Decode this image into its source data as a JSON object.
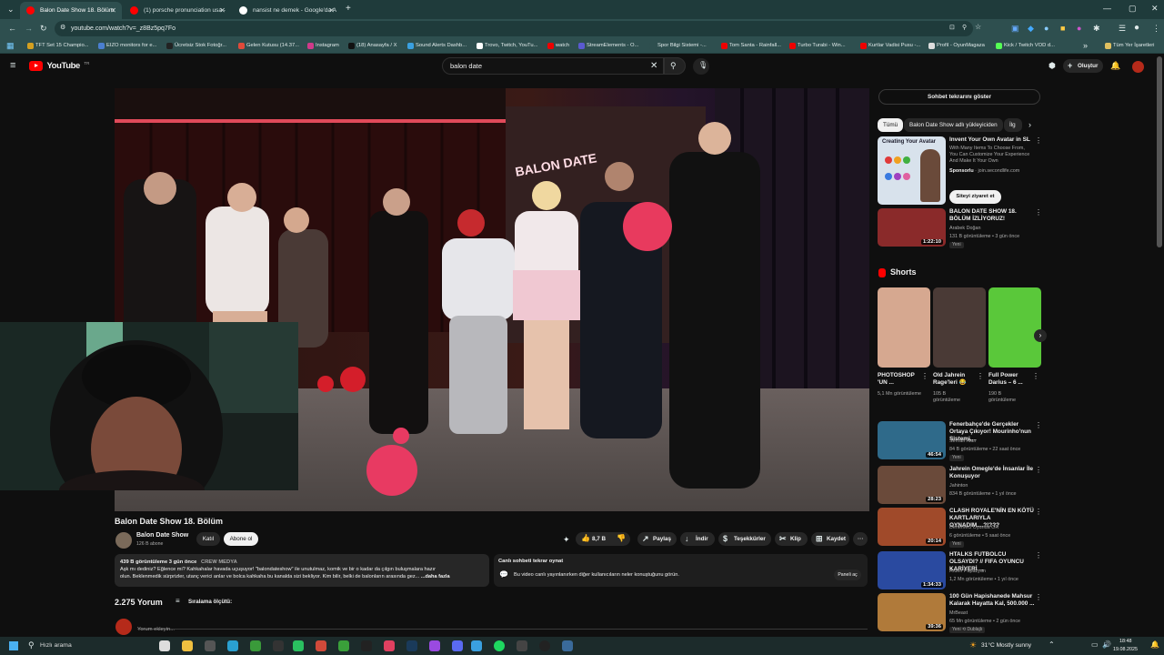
{
  "browser": {
    "tabs": [
      {
        "label": "Balon Date Show 18. Bölüm",
        "active": true
      },
      {
        "label": "(1) porsche pronunciation usa -",
        "active": false
      },
      {
        "label": "nansist ne demek - Google'da A",
        "active": false
      }
    ],
    "new_tab": "+",
    "url": "youtube.com/watch?v=_z8Bz5pq7Fo",
    "bookmarks": [
      "TFT Set 15 Champio...",
      "EIZO monitors for e...",
      "Ücretsiz Stok Fotoğr...",
      "Gelen Kutusu (14.37...",
      "Instagram",
      "(18) Anasayfa / X",
      "Sound Alerts Dashb...",
      "Trovo, Twitch, YouTu...",
      "watch",
      "StreamElements - O...",
      "Spor Bilgi Sistemi -...",
      "Tom Santa - Rainfall...",
      "Turbo Turabi - Win...",
      "Kurtlar Vadisi Pusu -...",
      "Profil - OyunMagaza",
      "Kick / Twitch VOD d..."
    ],
    "all_bookmarks": "Tüm Yer İşaretleri"
  },
  "youtube": {
    "logo": "YouTube",
    "country": "TR",
    "search_value": "balon date",
    "create_label": "Oluştur"
  },
  "video": {
    "title": "Balon Date Show 18. Bölüm",
    "overlay_text": "BALON DATE",
    "channel": "Balon Date Show",
    "subscribers": "126 B abone",
    "join_label": "Katıl",
    "subscribe_label": "Abone ol",
    "likes": "8,7 B",
    "share_label": "Paylaş",
    "download_label": "İndir",
    "thanks_label": "Teşekkürler",
    "clip_label": "Klip",
    "save_label": "Kaydet",
    "desc_stats": "439 B görüntüleme  3 gün önce",
    "desc_tag": "CREW MEDYA",
    "desc_line1": "Aşk mı dediniz? Eğlence mi? Kahkahalar havada uçuşuyor! \"balondateshow\" ile unutulmaz, komik ve bir o kadar da çılgın buluşmalara hazır",
    "desc_line2": "olun. Beklenmedik sürprizler, utanç verici anlar ve bolca kahkaha bu kanalda sizi bekliyor. Kim bilir, belki de balonların arasında gez...",
    "desc_more": "...daha fazla",
    "chat_replay_title": "Canlı sohbeti tekrar oynat",
    "chat_replay_text": "Bu video canlı yayınlanırken diğer kullanıcıların neler konuştuğunu görün.",
    "chat_open": "Paneli aç",
    "comments_count": "2.275 Yorum",
    "sort_label": "Sıralama ölçütü:",
    "comment_placeholder": "Yorum ekleyin..."
  },
  "sidebar": {
    "chat_button": "Sohbet tekrarını göster",
    "chips": [
      "Tümü",
      "Balon Date Show adlı yükleyiciden",
      "İlg"
    ],
    "ad": {
      "thumb_title": "Creating Your Avatar",
      "title": "Invent Your Own Avatar in SL",
      "desc": "With Many Items To Choose From, You Can Customize Your Experience And Make It Your Own",
      "sponsor": "Sponsorlu",
      "url": "join.secondlife.com",
      "cta": "Siteyi ziyaret et"
    },
    "top_video": {
      "title": "BALON DATE SHOW 18. BÖLÜM İZLİYORUZ!",
      "channel": "Arabek Doğan",
      "meta": "131 B görüntüleme • 3 gün önce",
      "duration": "1:22:10",
      "badge": "Yeni"
    },
    "shorts_label": "Shorts",
    "shorts": [
      {
        "title": "PHOTOSHOP 'UN ...",
        "views": "5,1 Mn görüntüleme"
      },
      {
        "title": "Old Jahrein Rage'leri 😂",
        "views": "105 B görüntüleme"
      },
      {
        "title": "Full Power Darius – 6 ...",
        "views": "190 B görüntüleme"
      }
    ],
    "videos": [
      {
        "title": "Fenerbahçe'de Gerçekler Ortaya Çıkıyor! Mourinho'nun Sistemi,...",
        "channel": "Serhan Alan",
        "meta": "84 B görüntüleme • 22 saat önce",
        "duration": "46:54",
        "badge": "Yeni",
        "color": "#2f6a8a"
      },
      {
        "title": "Jahrein Omegle'de İnsanlar İle Konuşuyor",
        "channel": "Jahinton",
        "meta": "834 B görüntüleme • 1 yıl önce",
        "duration": "28:23",
        "badge": "",
        "color": "#6a4a3a"
      },
      {
        "title": "CLASH ROYALE'NİN EN KÖTÜ KARTLARIYLA OYNADIM....?!???",
        "channel": "Denemeci Oyunda OR",
        "meta": "6 görüntüleme • 5 saat önce",
        "duration": "20:14",
        "badge": "Yeni",
        "color": "#a04a2a"
      },
      {
        "title": "HTALKS FUTBOLCU OLSAYDI? // FIFA OYUNCU KARİYERİ ...",
        "channel": "Arden Papazyan",
        "meta": "1,2 Mn görüntüleme • 1 yıl önce",
        "duration": "1:34:33",
        "badge": "",
        "color": "#2a4aa0"
      },
      {
        "title": "100 Gün Hapishanede Mahsur Kalarak Hayatta Kal, 500.000 ...",
        "channel": "MrBeast",
        "meta": "65 Mn görüntüleme • 2 gün önce",
        "duration": "39:36",
        "badge": "Yeni  ⟲ Dublajlı",
        "color": "#b07a3a"
      }
    ]
  },
  "taskbar": {
    "search_placeholder": "Hızlı arama",
    "weather": "31°C  Mostly sunny",
    "time": "18:48",
    "date": "19.08.2025"
  },
  "colors": {
    "accent": "#ff0000",
    "chrome": "#2e4f4f",
    "bg": "#0f0f0f"
  }
}
